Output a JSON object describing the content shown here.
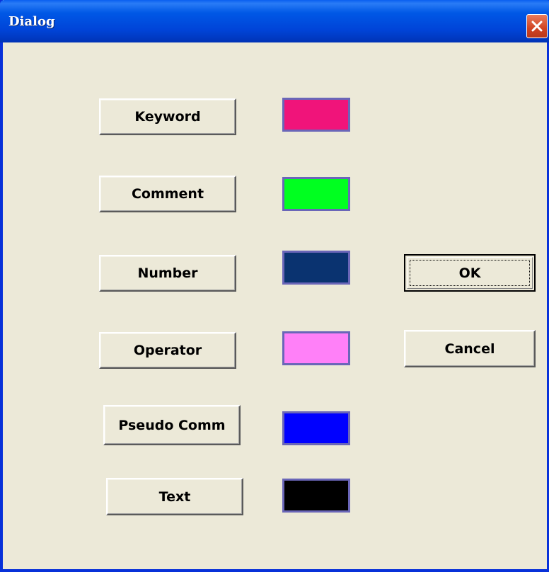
{
  "window": {
    "title": "Dialog"
  },
  "color_items": [
    {
      "label": "Keyword",
      "color": "#f0147a"
    },
    {
      "label": "Comment",
      "color": "#00ff20"
    },
    {
      "label": "Number",
      "color": "#0a3370"
    },
    {
      "label": "Operator",
      "color": "#ff80f8"
    },
    {
      "label": "Pseudo Comm",
      "color": "#0000ff"
    },
    {
      "label": "Text",
      "color": "#000000"
    }
  ],
  "actions": {
    "ok_label": "OK",
    "cancel_label": "Cancel"
  },
  "icons": {
    "close": "close-icon"
  }
}
